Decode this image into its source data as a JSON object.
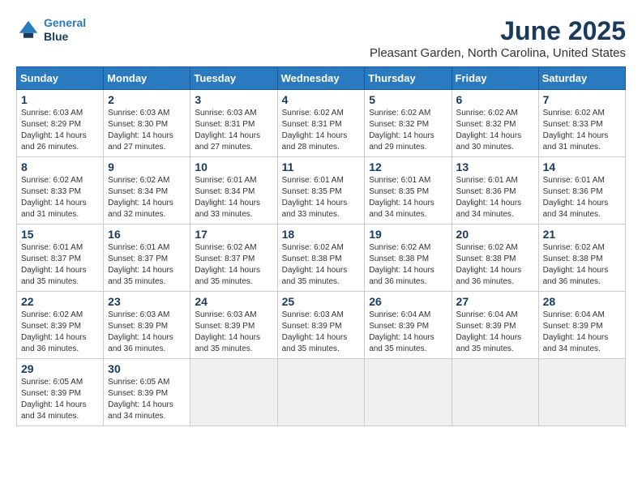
{
  "header": {
    "logo_line1": "General",
    "logo_line2": "Blue",
    "month": "June 2025",
    "location": "Pleasant Garden, North Carolina, United States"
  },
  "weekdays": [
    "Sunday",
    "Monday",
    "Tuesday",
    "Wednesday",
    "Thursday",
    "Friday",
    "Saturday"
  ],
  "weeks": [
    [
      {
        "day": "1",
        "info": "Sunrise: 6:03 AM\nSunset: 8:29 PM\nDaylight: 14 hours\nand 26 minutes."
      },
      {
        "day": "2",
        "info": "Sunrise: 6:03 AM\nSunset: 8:30 PM\nDaylight: 14 hours\nand 27 minutes."
      },
      {
        "day": "3",
        "info": "Sunrise: 6:03 AM\nSunset: 8:31 PM\nDaylight: 14 hours\nand 27 minutes."
      },
      {
        "day": "4",
        "info": "Sunrise: 6:02 AM\nSunset: 8:31 PM\nDaylight: 14 hours\nand 28 minutes."
      },
      {
        "day": "5",
        "info": "Sunrise: 6:02 AM\nSunset: 8:32 PM\nDaylight: 14 hours\nand 29 minutes."
      },
      {
        "day": "6",
        "info": "Sunrise: 6:02 AM\nSunset: 8:32 PM\nDaylight: 14 hours\nand 30 minutes."
      },
      {
        "day": "7",
        "info": "Sunrise: 6:02 AM\nSunset: 8:33 PM\nDaylight: 14 hours\nand 31 minutes."
      }
    ],
    [
      {
        "day": "8",
        "info": "Sunrise: 6:02 AM\nSunset: 8:33 PM\nDaylight: 14 hours\nand 31 minutes."
      },
      {
        "day": "9",
        "info": "Sunrise: 6:02 AM\nSunset: 8:34 PM\nDaylight: 14 hours\nand 32 minutes."
      },
      {
        "day": "10",
        "info": "Sunrise: 6:01 AM\nSunset: 8:34 PM\nDaylight: 14 hours\nand 33 minutes."
      },
      {
        "day": "11",
        "info": "Sunrise: 6:01 AM\nSunset: 8:35 PM\nDaylight: 14 hours\nand 33 minutes."
      },
      {
        "day": "12",
        "info": "Sunrise: 6:01 AM\nSunset: 8:35 PM\nDaylight: 14 hours\nand 34 minutes."
      },
      {
        "day": "13",
        "info": "Sunrise: 6:01 AM\nSunset: 8:36 PM\nDaylight: 14 hours\nand 34 minutes."
      },
      {
        "day": "14",
        "info": "Sunrise: 6:01 AM\nSunset: 8:36 PM\nDaylight: 14 hours\nand 34 minutes."
      }
    ],
    [
      {
        "day": "15",
        "info": "Sunrise: 6:01 AM\nSunset: 8:37 PM\nDaylight: 14 hours\nand 35 minutes."
      },
      {
        "day": "16",
        "info": "Sunrise: 6:01 AM\nSunset: 8:37 PM\nDaylight: 14 hours\nand 35 minutes."
      },
      {
        "day": "17",
        "info": "Sunrise: 6:02 AM\nSunset: 8:37 PM\nDaylight: 14 hours\nand 35 minutes."
      },
      {
        "day": "18",
        "info": "Sunrise: 6:02 AM\nSunset: 8:38 PM\nDaylight: 14 hours\nand 35 minutes."
      },
      {
        "day": "19",
        "info": "Sunrise: 6:02 AM\nSunset: 8:38 PM\nDaylight: 14 hours\nand 36 minutes."
      },
      {
        "day": "20",
        "info": "Sunrise: 6:02 AM\nSunset: 8:38 PM\nDaylight: 14 hours\nand 36 minutes."
      },
      {
        "day": "21",
        "info": "Sunrise: 6:02 AM\nSunset: 8:38 PM\nDaylight: 14 hours\nand 36 minutes."
      }
    ],
    [
      {
        "day": "22",
        "info": "Sunrise: 6:02 AM\nSunset: 8:39 PM\nDaylight: 14 hours\nand 36 minutes."
      },
      {
        "day": "23",
        "info": "Sunrise: 6:03 AM\nSunset: 8:39 PM\nDaylight: 14 hours\nand 36 minutes."
      },
      {
        "day": "24",
        "info": "Sunrise: 6:03 AM\nSunset: 8:39 PM\nDaylight: 14 hours\nand 35 minutes."
      },
      {
        "day": "25",
        "info": "Sunrise: 6:03 AM\nSunset: 8:39 PM\nDaylight: 14 hours\nand 35 minutes."
      },
      {
        "day": "26",
        "info": "Sunrise: 6:04 AM\nSunset: 8:39 PM\nDaylight: 14 hours\nand 35 minutes."
      },
      {
        "day": "27",
        "info": "Sunrise: 6:04 AM\nSunset: 8:39 PM\nDaylight: 14 hours\nand 35 minutes."
      },
      {
        "day": "28",
        "info": "Sunrise: 6:04 AM\nSunset: 8:39 PM\nDaylight: 14 hours\nand 34 minutes."
      }
    ],
    [
      {
        "day": "29",
        "info": "Sunrise: 6:05 AM\nSunset: 8:39 PM\nDaylight: 14 hours\nand 34 minutes."
      },
      {
        "day": "30",
        "info": "Sunrise: 6:05 AM\nSunset: 8:39 PM\nDaylight: 14 hours\nand 34 minutes."
      },
      null,
      null,
      null,
      null,
      null
    ]
  ]
}
